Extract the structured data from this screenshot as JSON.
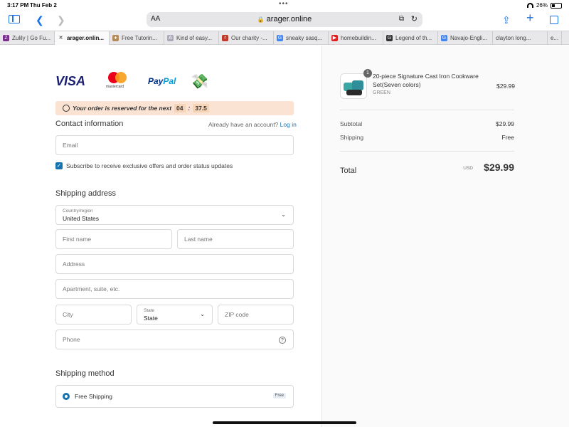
{
  "status": {
    "time": "3:17 PM",
    "date": "Thu Feb 2",
    "battery": "26%"
  },
  "browser": {
    "aa_label": "AA",
    "url": "arager.online",
    "tabs": [
      {
        "label": "Zulily | Go Fu...",
        "icon": "zulily-icon",
        "color": "#7b2d8e",
        "glyph": "Z",
        "active": false
      },
      {
        "label": "arager.onlin...",
        "icon": "close-icon",
        "color": "#777",
        "glyph": "✕",
        "active": true
      },
      {
        "label": "Free Tutorin...",
        "icon": "tutoring-icon",
        "color": "#b58b5a",
        "glyph": "♦",
        "active": false
      },
      {
        "label": "Kind of easy...",
        "icon": "kind-icon",
        "color": "#aab",
        "glyph": "A",
        "active": false
      },
      {
        "label": "Our charity -...",
        "icon": "charity-icon",
        "color": "#c0392b",
        "glyph": "r",
        "active": false
      },
      {
        "label": "sneaky sasq...",
        "icon": "google-icon",
        "color": "#4285f4",
        "glyph": "G",
        "active": false
      },
      {
        "label": "homebuildin...",
        "icon": "youtube-icon",
        "color": "#e02020",
        "glyph": "▶",
        "active": false
      },
      {
        "label": "Legend of th...",
        "icon": "legend-icon",
        "color": "#333",
        "glyph": "G",
        "active": false
      },
      {
        "label": "Navajo-Engli...",
        "icon": "google-icon",
        "color": "#4285f4",
        "glyph": "G",
        "active": false
      },
      {
        "label": "clayton long...",
        "icon": "none",
        "color": "transparent",
        "glyph": "",
        "active": false
      },
      {
        "label": "e...",
        "icon": "none",
        "color": "transparent",
        "glyph": "",
        "active": false
      }
    ]
  },
  "checkout": {
    "payment_logos": {
      "visa": "VISA",
      "mastercard": "mastercard",
      "paypal_a": "Pay",
      "paypal_b": "Pal"
    },
    "reserve_text": "Your order is reserved for the next",
    "timer_min": "04",
    "timer_sep": ":",
    "timer_sec": "37.5",
    "contact_heading": "Contact information",
    "account_prompt": "Already have an account?",
    "login_link": "Log in",
    "email_placeholder": "Email",
    "subscribe_label": "Subscribe to receive exclusive offers and order status updates",
    "shipping_heading": "Shipping address",
    "country_label": "Country/region",
    "country_value": "United States",
    "first_name_placeholder": "First name",
    "last_name_placeholder": "Last name",
    "address_placeholder": "Address",
    "apartment_placeholder": "Apartment, suite, etc.",
    "city_placeholder": "City",
    "state_label": "State",
    "state_value": "State",
    "zip_placeholder": "ZIP code",
    "phone_placeholder": "Phone",
    "method_heading": "Shipping method",
    "method_label": "Free Shipping",
    "method_badge": "Free"
  },
  "summary": {
    "quantity": "1",
    "product_name": "20-piece Signature Cast Iron Cookware Set(Seven colors)",
    "variant": "GREEN",
    "product_price": "$29.99",
    "subtotal_label": "Subtotal",
    "subtotal_value": "$29.99",
    "shipping_label": "Shipping",
    "shipping_value": "Free",
    "total_label": "Total",
    "currency": "USD",
    "total_value": "$29.99"
  }
}
